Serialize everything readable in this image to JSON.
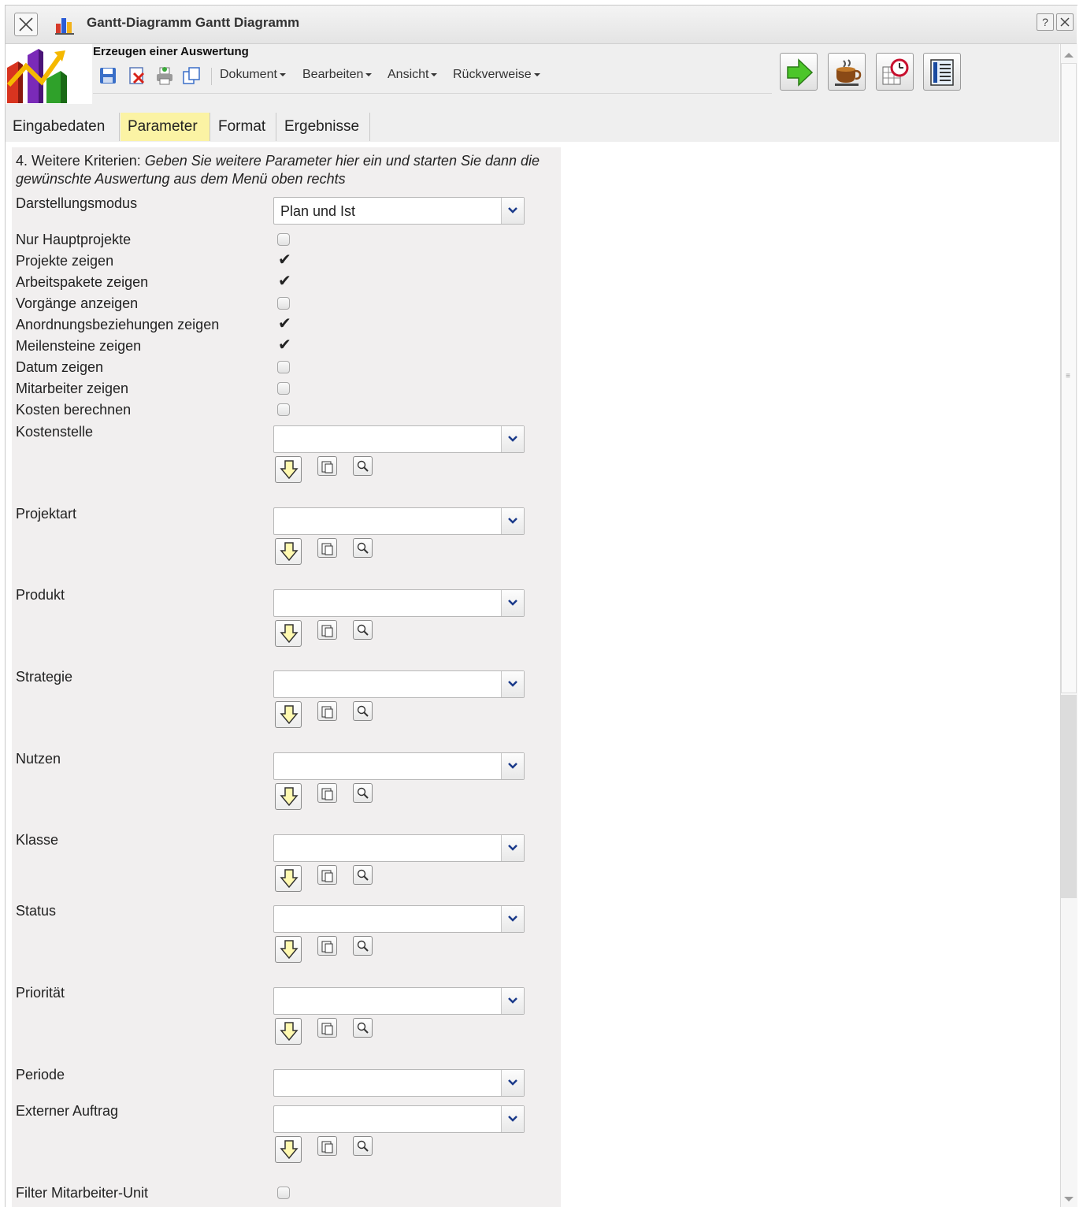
{
  "window": {
    "title": "Gantt-Diagramm Gantt Diagramm",
    "help_label": "?"
  },
  "header": {
    "title": "Erzeugen einer Auswertung",
    "menus": [
      "Dokument",
      "Bearbeiten",
      "Ansicht",
      "Rückverweise"
    ]
  },
  "tabs": [
    {
      "label": "Eingabedaten",
      "active": false
    },
    {
      "label": "Parameter",
      "active": true
    },
    {
      "label": "Format",
      "active": false
    },
    {
      "label": "Ergebnisse",
      "active": false
    }
  ],
  "form": {
    "intro_prefix": "4. Weitere Kriterien: ",
    "intro_text": "Geben Sie weitere Parameter hier ein und starten Sie dann die gewünschte Auswertung aus dem Menü oben rechts",
    "darstellungsmodus": {
      "label": "Darstellungsmodus",
      "value": "Plan und Ist"
    },
    "checkboxes": [
      {
        "label": "Nur Hauptprojekte",
        "checked": false
      },
      {
        "label": "Projekte zeigen",
        "checked": true
      },
      {
        "label": "Arbeitspakete zeigen",
        "checked": true
      },
      {
        "label": "Vorgänge anzeigen",
        "checked": false
      },
      {
        "label": "Anordnungsbeziehungen zeigen",
        "checked": true
      },
      {
        "label": "Meilensteine zeigen",
        "checked": true
      },
      {
        "label": "Datum zeigen",
        "checked": false
      },
      {
        "label": "Mitarbeiter zeigen",
        "checked": false
      },
      {
        "label": "Kosten berechnen",
        "checked": false
      }
    ],
    "selects": [
      {
        "label": "Kostenstelle",
        "value": ""
      },
      {
        "label": "Projektart",
        "value": ""
      },
      {
        "label": "Produkt",
        "value": ""
      },
      {
        "label": "Strategie",
        "value": ""
      },
      {
        "label": "Nutzen",
        "value": ""
      },
      {
        "label": "Klasse",
        "value": ""
      },
      {
        "label": "Status",
        "value": ""
      },
      {
        "label": "Priorität",
        "value": ""
      },
      {
        "label": "Periode",
        "value": ""
      },
      {
        "label": "Externer Auftrag",
        "value": ""
      }
    ],
    "filter": {
      "label": "Filter Mitarbeiter-Unit",
      "checked": false
    }
  },
  "colors": {
    "active_tab": "#fbf3a4",
    "panel_bg": "#f1efef",
    "header_bg": "#efefef"
  }
}
